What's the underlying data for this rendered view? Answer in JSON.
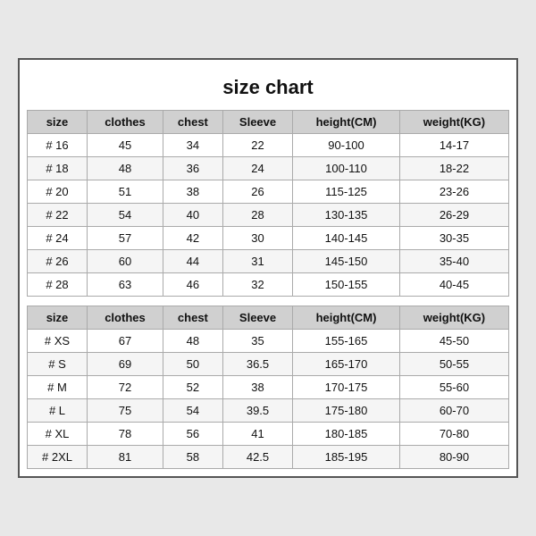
{
  "title": "size chart",
  "headers": [
    "size",
    "clothes",
    "chest",
    "Sleeve",
    "height(CM)",
    "weight(KG)"
  ],
  "section1": [
    [
      "# 16",
      "45",
      "34",
      "22",
      "90-100",
      "14-17"
    ],
    [
      "# 18",
      "48",
      "36",
      "24",
      "100-110",
      "18-22"
    ],
    [
      "# 20",
      "51",
      "38",
      "26",
      "115-125",
      "23-26"
    ],
    [
      "# 22",
      "54",
      "40",
      "28",
      "130-135",
      "26-29"
    ],
    [
      "# 24",
      "57",
      "42",
      "30",
      "140-145",
      "30-35"
    ],
    [
      "# 26",
      "60",
      "44",
      "31",
      "145-150",
      "35-40"
    ],
    [
      "# 28",
      "63",
      "46",
      "32",
      "150-155",
      "40-45"
    ]
  ],
  "section2": [
    [
      "# XS",
      "67",
      "48",
      "35",
      "155-165",
      "45-50"
    ],
    [
      "# S",
      "69",
      "50",
      "36.5",
      "165-170",
      "50-55"
    ],
    [
      "# M",
      "72",
      "52",
      "38",
      "170-175",
      "55-60"
    ],
    [
      "# L",
      "75",
      "54",
      "39.5",
      "175-180",
      "60-70"
    ],
    [
      "# XL",
      "78",
      "56",
      "41",
      "180-185",
      "70-80"
    ],
    [
      "# 2XL",
      "81",
      "58",
      "42.5",
      "185-195",
      "80-90"
    ]
  ]
}
